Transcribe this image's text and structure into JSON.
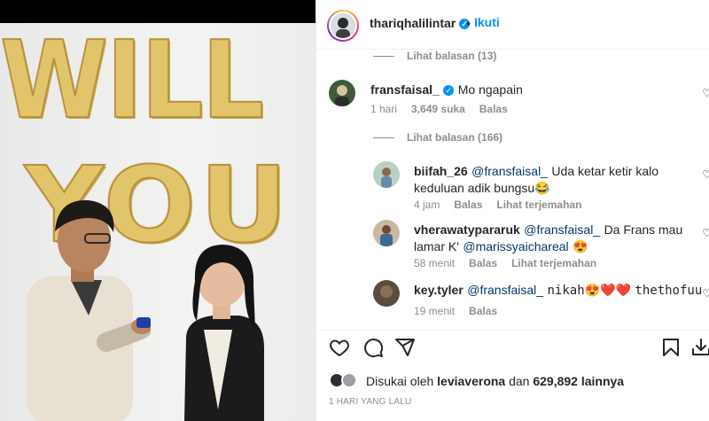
{
  "post": {
    "balloon_text_line1": "WILL",
    "balloon_text_line2": "YOU"
  },
  "header": {
    "username": "thariqhalilintar",
    "verified_icon": "verified-badge-icon",
    "separator": "•",
    "follow_label": "Ikuti"
  },
  "comments": {
    "view_replies_top": "Lihat balasan (13)",
    "main": {
      "username": "fransfaisal_",
      "text": "Mo ngapain",
      "time": "1 hari",
      "likes": "3,649 suka",
      "reply_label": "Balas",
      "view_replies": "Lihat balasan (166)"
    },
    "replies": [
      {
        "username": "biifah_26",
        "mention": "@fransfaisal_",
        "text": "Uda ketar ketir kalo keduluan adik bungsu",
        "emoji": "😂",
        "time": "4 jam",
        "reply_label": "Balas",
        "translate_label": "Lihat terjemahan"
      },
      {
        "username": "vherawatypararuk",
        "mention": "@fransfaisal_",
        "text": "Da Frans mau lamar K'",
        "mention2": "@marissyaichareal",
        "emoji": "😍",
        "time": "58 menit",
        "reply_label": "Balas",
        "translate_label": "Lihat terjemahan"
      },
      {
        "username": "key.tyler",
        "mention": "@fransfaisal_",
        "text": "nikah",
        "emoji": "😍❤️❤️",
        "text2": "thethofuu",
        "time": "19 menit",
        "reply_label": "Balas"
      }
    ]
  },
  "actions": {
    "like_icon": "heart-icon",
    "comment_icon": "comment-icon",
    "share_icon": "share-icon",
    "save_icon": "bookmark-icon",
    "download_icon": "download-icon"
  },
  "likes": {
    "prefix": "Disukai oleh",
    "user": "leviaverona",
    "middle": "dan",
    "count": "629,892 lainnya"
  },
  "posted": "1 HARI YANG LALU",
  "colors": {
    "accent": "#0095f6",
    "mention": "#00376b",
    "muted": "#8e8e8e",
    "heart_red": "#ed4956"
  }
}
